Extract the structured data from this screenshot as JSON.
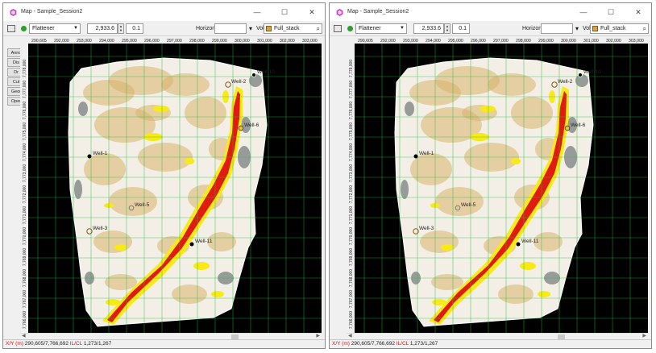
{
  "windows": [
    {
      "title": "Map - Sample_Session2",
      "flattener": "Flattener",
      "depth_value": "2,933.6",
      "step_value": "0.1",
      "horizon_label": "Horizon",
      "horizon_value": "",
      "vol_label": "Vol",
      "vol_value": "Full_stack",
      "side_tabs": [
        "Anno",
        "Dis",
        "Dr",
        "Cul",
        "Geor",
        "Oper"
      ],
      "x_ticks": [
        "290,605",
        "292,000",
        "293,000",
        "294,000",
        "295,000",
        "296,000",
        "297,000",
        "298,000",
        "299,000",
        "300,000",
        "301,000",
        "302,000",
        "303,000"
      ],
      "y_ticks": [
        "7,778,000",
        "7,777,000",
        "7,776,000",
        "7,775,000",
        "7,774,000",
        "7,773,000",
        "7,772,000",
        "7,771,000",
        "7,770,000",
        "7,769,000",
        "7,768,000",
        "7,767,000",
        "7,766,000"
      ],
      "wells": [
        "Well-10",
        "Well-2",
        "Well-6",
        "Well-1",
        "Well-5",
        "Well-3",
        "Well-11"
      ],
      "status": {
        "xy_label": "X/Y (m)",
        "xy_value": "290,605/7,766,692",
        "ilcl_label": "IL/CL",
        "ilcl_value": "1,273/1,267"
      }
    },
    {
      "title": "Map - Sample_Session2",
      "flattener": "Flattener",
      "depth_value": "2,933.6",
      "step_value": "0.1",
      "horizon_label": "Horizon",
      "horizon_value": "",
      "vol_label": "Vol",
      "vol_value": "Full_stack",
      "side_tabs": [],
      "x_ticks": [
        "290,605",
        "292,000",
        "293,000",
        "294,000",
        "295,000",
        "296,000",
        "297,000",
        "298,000",
        "299,000",
        "300,000",
        "301,000",
        "302,000",
        "303,000"
      ],
      "y_ticks": [
        "7,778,000",
        "7,777,000",
        "7,776,000",
        "7,775,000",
        "7,774,000",
        "7,773,000",
        "7,772,000",
        "7,771,000",
        "7,770,000",
        "7,769,000",
        "7,768,000",
        "7,767,000",
        "7,766,000"
      ],
      "wells": [
        "Well-10",
        "Well-2",
        "Well-6",
        "Well-1",
        "Well-5",
        "Well-3",
        "Well-11"
      ],
      "status": {
        "xy_label": "X/Y (m)",
        "xy_value": "290,605/7,766,692",
        "ilcl_label": "IL/CL",
        "ilcl_value": "1,273/1,267"
      }
    }
  ],
  "window_controls": {
    "minimize": "—",
    "maximize": "☐",
    "close": "✕"
  },
  "colors": {
    "app_icon": "#c040c0",
    "status_ok": "#2e9e2e",
    "map_background": "#000000",
    "grid": "#1fbf3f",
    "amplitude_strong": "#e21b12",
    "amplitude_medium": "#f7ea16",
    "amplitude_low": "#d9b36a",
    "status_red": "#d0141b"
  }
}
